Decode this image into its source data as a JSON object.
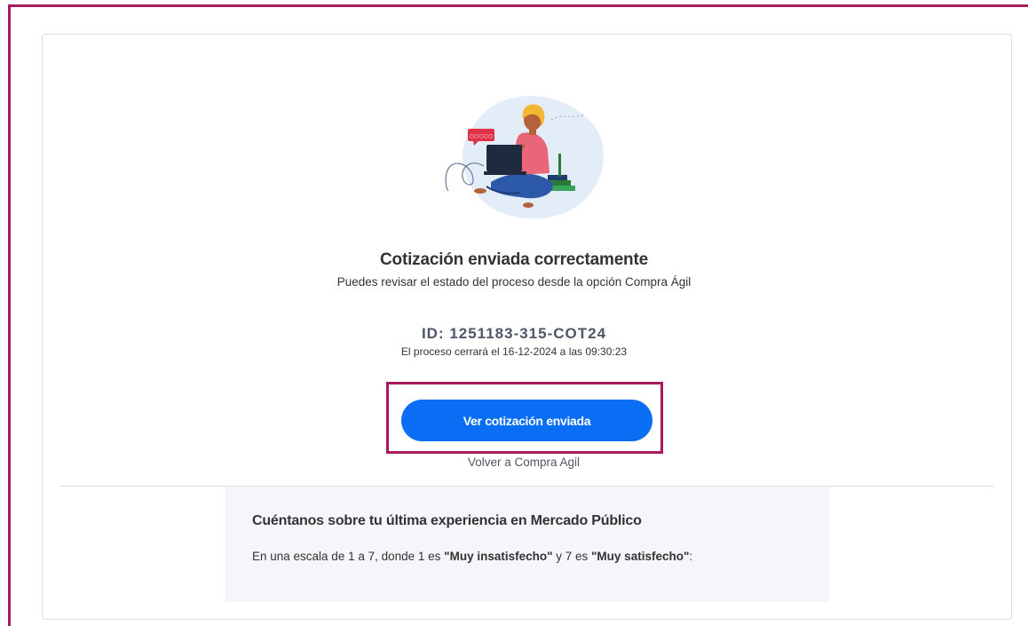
{
  "confirmation": {
    "title": "Cotización enviada correctamente",
    "subtitle": "Puedes revisar el estado del proceso desde la opción Compra Ágil",
    "quote_id": "ID: 1251183-315-COT24",
    "close_note": "El proceso cerrará el 16-12-2024 a las 09:30:23"
  },
  "actions": {
    "view_quote_label": "Ver cotización enviada",
    "back_label": "Volver a Compra Agil"
  },
  "survey": {
    "title": "Cuéntanos sobre tu última experiencia en Mercado Público",
    "question_prefix": "En una escala de 1 a 7, donde 1 es ",
    "scale_min_label": "\"Muy insatisfecho\"",
    "question_middle": " y 7 es ",
    "scale_max_label": "\"Muy satisfecho\"",
    "question_suffix": ":"
  },
  "illustration": {
    "icon": "woman-with-laptop-illustration",
    "chat_bubble_text": "○○○○○"
  },
  "colors": {
    "primary_button": "#0a6ef5",
    "highlight_border": "#a8195e",
    "survey_background": "#f4f6fa"
  }
}
